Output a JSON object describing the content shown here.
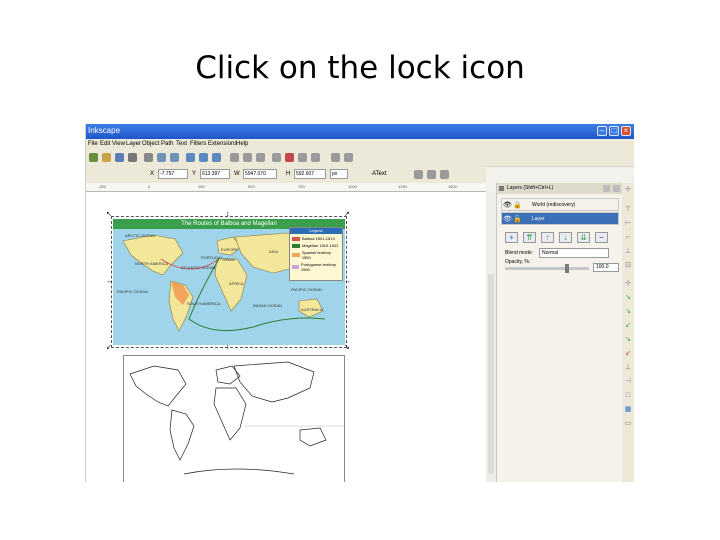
{
  "slide": {
    "title": "Click on the lock icon"
  },
  "window": {
    "title": "Inkscape"
  },
  "menu": {
    "items": [
      "File",
      "Edit",
      "View",
      "Layer",
      "Object",
      "Path",
      "Text",
      "Filters",
      "Extensions",
      "Help"
    ]
  },
  "toolbar": {
    "x_label": "X",
    "x_value": "-7.797",
    "y_label": "Y",
    "y_value": "613.397",
    "w_label": "W",
    "w_value": "5947.070",
    "h_label": "H",
    "h_value": "592.607",
    "unit": "px",
    "text_label": "AText"
  },
  "ruler": {
    "ticks": [
      "-250",
      "0",
      "250",
      "500",
      "750",
      "1000",
      "1250",
      "1500"
    ]
  },
  "map": {
    "header": "The Routes of Balboa and Magellan",
    "legend_title": "Legend",
    "legend": [
      {
        "label": "Balboa 1501-1513",
        "color": "#d9534f"
      },
      {
        "label": "Magellan 1519-1522",
        "color": "#2e7d32"
      },
      {
        "label": "Spanish territory 1550",
        "color": "#f2a55a"
      },
      {
        "label": "Portuguese territory 1550",
        "color": "#c9a0dc"
      }
    ],
    "labels": [
      "ARCTIC OCEAN",
      "NORTH AMERICA",
      "ATLANTIC OCEAN",
      "EUROPE",
      "PORTUGAL",
      "SPAIN",
      "AFRICA",
      "ASIA",
      "PACIFIC OCEAN",
      "SOUTH AMERICA",
      "INDIAN OCEAN",
      "AUSTRALIA",
      "PACIFIC OCEAN"
    ]
  },
  "layers": {
    "panel_title": "Layers (Shift+Ctrl+L)",
    "items": [
      {
        "name": "World (rediscovery)",
        "selected": false
      },
      {
        "name": "Layer",
        "selected": true
      }
    ],
    "blend_label": "Blend mode:",
    "blend_value": "Normal",
    "opacity_label": "Opacity, %:",
    "opacity_value": "100.0"
  },
  "colors": {
    "titlebar": "#2a63d4",
    "selection": "#3b6fb6",
    "map_header": "#3a9f4c"
  }
}
